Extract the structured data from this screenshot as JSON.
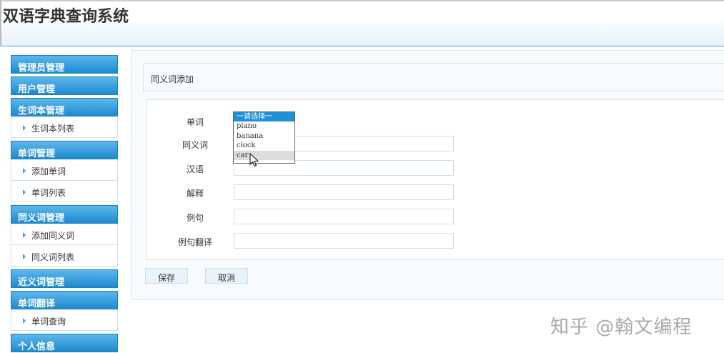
{
  "header": {
    "title": "双语字典查询系统"
  },
  "sidebar": {
    "groups": [
      {
        "label": "管理员管理",
        "items": []
      },
      {
        "label": "用户管理",
        "items": []
      },
      {
        "label": "生词本管理",
        "items": [
          "生词本列表"
        ]
      },
      {
        "label": "单词管理",
        "items": [
          "添加单词",
          "单词列表"
        ]
      },
      {
        "label": "同义词管理",
        "items": [
          "添加同义词",
          "同义词列表"
        ]
      },
      {
        "label": "近义词管理",
        "items": []
      },
      {
        "label": "单词翻译",
        "items": [
          "单词查询"
        ]
      },
      {
        "label": "个人信息",
        "items": []
      }
    ]
  },
  "main": {
    "panel_title": "同义词添加",
    "fields": [
      {
        "label": "单词",
        "value": ""
      },
      {
        "label": "同义词",
        "value": ""
      },
      {
        "label": "汉语",
        "value": ""
      },
      {
        "label": "解释",
        "value": ""
      },
      {
        "label": "例句",
        "value": ""
      },
      {
        "label": "例句翻译",
        "value": ""
      }
    ],
    "word_dropdown": {
      "options": [
        "一请选择一",
        "piano",
        "banana",
        "clock",
        "car"
      ],
      "selected": "一请选择一",
      "hovered": "car"
    },
    "save_label": "保存",
    "cancel_label": "取消"
  },
  "watermark": "知乎 @翰文编程"
}
